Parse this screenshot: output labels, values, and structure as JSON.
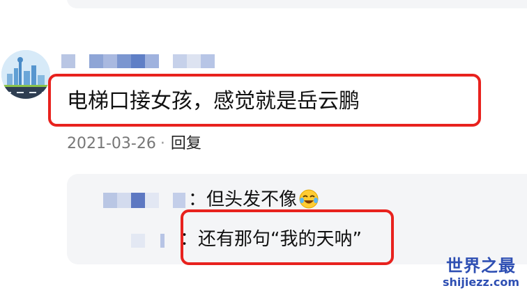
{
  "comment": {
    "text": "电梯口接女孩，感觉就是岳云鹏",
    "date": "2021-03-26",
    "separator": "·",
    "reply_label": "回复"
  },
  "replies": [
    {
      "text": "：但头发不像",
      "emoji": "laughing-crying-emoji"
    },
    {
      "text": "：还有那句“我的天呐”"
    }
  ],
  "watermark": {
    "title": "世界之最",
    "url": "shijiezz.com"
  },
  "colors": {
    "highlight_border": "#e8221e",
    "watermark": "#2e4fb3",
    "panel_bg": "#f4f5f7"
  }
}
